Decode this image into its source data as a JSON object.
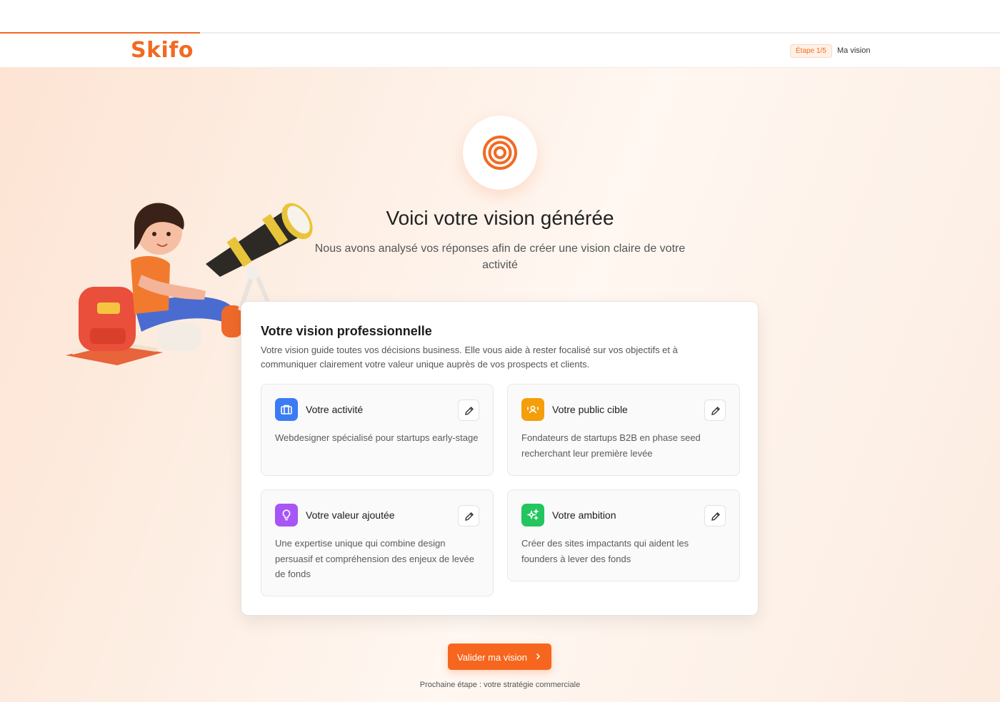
{
  "header": {
    "logo": "Skifo",
    "step_badge": "Étape 1/5",
    "step_name": "Ma vision",
    "progress": 0.2
  },
  "hero": {
    "icon": "target-icon",
    "title": "Voici votre vision générée",
    "subtitle": "Nous avons analysé vos réponses afin de créer une vision claire de votre activité",
    "illustration": "girl-with-telescope-illustration"
  },
  "vision_card": {
    "title": "Votre vision professionnelle",
    "description": "Votre vision guide toutes vos décisions business. Elle vous aide à rester focalisé sur vos objectifs et à communiquer clairement votre valeur unique auprès de vos prospects et clients.",
    "tiles": [
      {
        "title": "Votre activité",
        "text": "Webdesigner spécialisé pour startups early-stage",
        "icon": "briefcase-icon",
        "color": "#3b7cf5"
      },
      {
        "title": "Votre public cible",
        "text": "Fondateurs de startups B2B en phase seed recherchant leur première levée",
        "icon": "audience-icon",
        "color": "#f59e0b"
      },
      {
        "title": "Votre valeur ajoutée",
        "text": "Une expertise unique qui combine design persuasif et compréhension des enjeux de levée de fonds",
        "icon": "lightbulb-icon",
        "color": "#a855f7"
      },
      {
        "title": "Votre ambition",
        "text": "Créer des sites impactants qui aident les founders à lever des fonds",
        "icon": "sparkles-icon",
        "color": "#22c55e"
      }
    ]
  },
  "cta": {
    "label": "Valider ma vision",
    "next_step": "Prochaine étape : votre stratégie commerciale"
  },
  "colors": {
    "accent": "#f26a21",
    "button": "#f7661e"
  }
}
